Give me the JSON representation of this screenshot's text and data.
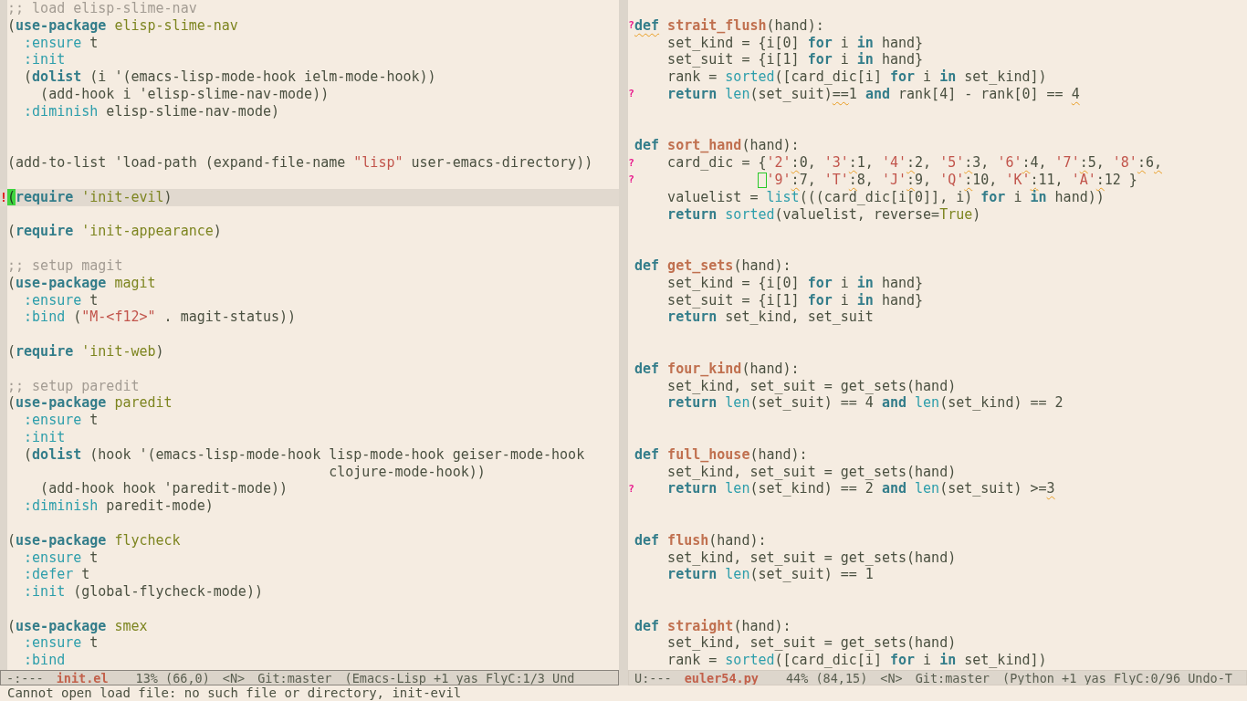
{
  "panes": [
    {
      "mode_line": {
        "active": true,
        "segments": [
          {
            "kind": "status",
            "text": "-:---"
          },
          {
            "kind": "buffer",
            "text": "init.el"
          },
          {
            "kind": "position",
            "text": "13% (66,0)"
          },
          {
            "kind": "state",
            "text": "<N>"
          },
          {
            "kind": "branch",
            "text": "Git:master"
          },
          {
            "kind": "modes",
            "text": "(Emacs-Lisp +1 yas FlyC:1/3 Und"
          }
        ]
      },
      "lines": [
        {
          "kind": "code",
          "current": false,
          "segments": [
            {
              "kind": "comment",
              "text": ";; load elisp-slime-nav"
            }
          ]
        },
        {
          "kind": "code",
          "current": false,
          "segments": [
            {
              "kind": "plain",
              "text": "("
            },
            {
              "kind": "keyword",
              "text": "use-package"
            },
            {
              "kind": "constant",
              "text": " elisp-slime-nav"
            }
          ]
        },
        {
          "kind": "code",
          "current": false,
          "segments": [
            {
              "kind": "builtin",
              "text": "  :ensure"
            },
            {
              "kind": "plain",
              "text": " t"
            }
          ]
        },
        {
          "kind": "code",
          "current": false,
          "segments": [
            {
              "kind": "builtin",
              "text": "  :init"
            }
          ]
        },
        {
          "kind": "code",
          "current": false,
          "segments": [
            {
              "kind": "plain",
              "text": "  ("
            },
            {
              "kind": "keyword",
              "text": "dolist"
            },
            {
              "kind": "plain",
              "text": " (i '(emacs-lisp-mode-hook ielm-mode-hook))"
            }
          ]
        },
        {
          "kind": "code",
          "current": false,
          "segments": [
            {
              "kind": "plain",
              "text": "    (add-hook i 'elisp-slime-nav-mode))"
            }
          ]
        },
        {
          "kind": "code",
          "current": false,
          "segments": [
            {
              "kind": "builtin",
              "text": "  :diminish"
            },
            {
              "kind": "plain",
              "text": " elisp-slime-nav-mode)"
            }
          ]
        },
        {
          "kind": "blank",
          "current": false
        },
        {
          "kind": "blank",
          "current": false
        },
        {
          "kind": "code",
          "current": false,
          "segments": [
            {
              "kind": "plain",
              "text": "(add-to-list 'load-path (expand-file-name "
            },
            {
              "kind": "string",
              "text": "\"lisp\""
            },
            {
              "kind": "plain",
              "text": " user-emacs-directory))"
            }
          ]
        },
        {
          "kind": "blank",
          "current": false
        },
        {
          "kind": "code",
          "current": true,
          "fringe": {
            "kind": "error",
            "text": "!"
          },
          "segments": [
            {
              "kind": "cursor",
              "text": "("
            },
            {
              "kind": "keyword",
              "text": "require"
            },
            {
              "kind": "constant",
              "text": " 'init-evil"
            },
            {
              "kind": "plain",
              "text": ")"
            }
          ]
        },
        {
          "kind": "blank",
          "current": false
        },
        {
          "kind": "code",
          "current": false,
          "segments": [
            {
              "kind": "plain",
              "text": "("
            },
            {
              "kind": "keyword",
              "text": "require"
            },
            {
              "kind": "constant",
              "text": " 'init-appearance"
            },
            {
              "kind": "plain",
              "text": ")"
            }
          ]
        },
        {
          "kind": "blank",
          "current": false
        },
        {
          "kind": "code",
          "current": false,
          "segments": [
            {
              "kind": "comment",
              "text": ";; setup magit"
            }
          ]
        },
        {
          "kind": "code",
          "current": false,
          "segments": [
            {
              "kind": "plain",
              "text": "("
            },
            {
              "kind": "keyword",
              "text": "use-package"
            },
            {
              "kind": "constant",
              "text": " magit"
            }
          ]
        },
        {
          "kind": "code",
          "current": false,
          "segments": [
            {
              "kind": "builtin",
              "text": "  :ensure"
            },
            {
              "kind": "plain",
              "text": " t"
            }
          ]
        },
        {
          "kind": "code",
          "current": false,
          "segments": [
            {
              "kind": "builtin",
              "text": "  :bind"
            },
            {
              "kind": "plain",
              "text": " ("
            },
            {
              "kind": "string",
              "text": "\"M-<f12>\""
            },
            {
              "kind": "plain",
              "text": " . magit-status))"
            }
          ]
        },
        {
          "kind": "blank",
          "current": false
        },
        {
          "kind": "code",
          "current": false,
          "segments": [
            {
              "kind": "plain",
              "text": "("
            },
            {
              "kind": "keyword",
              "text": "require"
            },
            {
              "kind": "constant",
              "text": " 'init-web"
            },
            {
              "kind": "plain",
              "text": ")"
            }
          ]
        },
        {
          "kind": "blank",
          "current": false
        },
        {
          "kind": "code",
          "current": false,
          "segments": [
            {
              "kind": "comment",
              "text": ";; setup paredit"
            }
          ]
        },
        {
          "kind": "code",
          "current": false,
          "segments": [
            {
              "kind": "plain",
              "text": "("
            },
            {
              "kind": "keyword",
              "text": "use-package"
            },
            {
              "kind": "constant",
              "text": " paredit"
            }
          ]
        },
        {
          "kind": "code",
          "current": false,
          "segments": [
            {
              "kind": "builtin",
              "text": "  :ensure"
            },
            {
              "kind": "plain",
              "text": " t"
            }
          ]
        },
        {
          "kind": "code",
          "current": false,
          "segments": [
            {
              "kind": "builtin",
              "text": "  :init"
            }
          ]
        },
        {
          "kind": "code",
          "current": false,
          "segments": [
            {
              "kind": "plain",
              "text": "  ("
            },
            {
              "kind": "keyword",
              "text": "dolist"
            },
            {
              "kind": "plain",
              "text": " (hook '(emacs-lisp-mode-hook lisp-mode-hook geiser-mode-hook"
            }
          ]
        },
        {
          "kind": "code",
          "current": false,
          "segments": [
            {
              "kind": "plain",
              "text": "                                       clojure-mode-hook))"
            }
          ]
        },
        {
          "kind": "code",
          "current": false,
          "segments": [
            {
              "kind": "plain",
              "text": "    (add-hook hook 'paredit-mode))"
            }
          ]
        },
        {
          "kind": "code",
          "current": false,
          "segments": [
            {
              "kind": "builtin",
              "text": "  :diminish"
            },
            {
              "kind": "plain",
              "text": " paredit-mode)"
            }
          ]
        },
        {
          "kind": "blank",
          "current": false
        },
        {
          "kind": "code",
          "current": false,
          "segments": [
            {
              "kind": "plain",
              "text": "("
            },
            {
              "kind": "keyword",
              "text": "use-package"
            },
            {
              "kind": "constant",
              "text": " flycheck"
            }
          ]
        },
        {
          "kind": "code",
          "current": false,
          "segments": [
            {
              "kind": "builtin",
              "text": "  :ensure"
            },
            {
              "kind": "plain",
              "text": " t"
            }
          ]
        },
        {
          "kind": "code",
          "current": false,
          "segments": [
            {
              "kind": "builtin",
              "text": "  :defer"
            },
            {
              "kind": "plain",
              "text": " t"
            }
          ]
        },
        {
          "kind": "code",
          "current": false,
          "segments": [
            {
              "kind": "builtin",
              "text": "  :init"
            },
            {
              "kind": "plain",
              "text": " (global-flycheck-mode))"
            }
          ]
        },
        {
          "kind": "blank",
          "current": false
        },
        {
          "kind": "code",
          "current": false,
          "segments": [
            {
              "kind": "plain",
              "text": "("
            },
            {
              "kind": "keyword",
              "text": "use-package"
            },
            {
              "kind": "constant",
              "text": " smex"
            }
          ]
        },
        {
          "kind": "code",
          "current": false,
          "segments": [
            {
              "kind": "builtin",
              "text": "  :ensure"
            },
            {
              "kind": "plain",
              "text": " t"
            }
          ]
        },
        {
          "kind": "code",
          "current": false,
          "segments": [
            {
              "kind": "builtin",
              "text": "  :bind"
            }
          ]
        }
      ]
    },
    {
      "mode_line": {
        "active": false,
        "segments": [
          {
            "kind": "status",
            "text": "U:---"
          },
          {
            "kind": "buffer",
            "text": "euler54.py"
          },
          {
            "kind": "position",
            "text": "44% (84,15)"
          },
          {
            "kind": "state",
            "text": "<N>"
          },
          {
            "kind": "branch",
            "text": "Git:master"
          },
          {
            "kind": "modes",
            "text": "(Python +1 yas FlyC:0/96 Undo-T"
          }
        ]
      },
      "lines": [
        {
          "kind": "blank"
        },
        {
          "kind": "code",
          "fringe": {
            "kind": "warning",
            "text": "?"
          },
          "segments": [
            {
              "kind": "flagged_keyword",
              "text": "def"
            },
            {
              "kind": "function",
              "text": " strait_flush"
            },
            {
              "kind": "plain",
              "text": "(hand):"
            }
          ]
        },
        {
          "kind": "code",
          "segments": [
            {
              "kind": "plain",
              "text": "    set_kind = {i[0] "
            },
            {
              "kind": "keyword",
              "text": "for"
            },
            {
              "kind": "plain",
              "text": " i "
            },
            {
              "kind": "keyword",
              "text": "in"
            },
            {
              "kind": "plain",
              "text": " hand}"
            }
          ]
        },
        {
          "kind": "code",
          "segments": [
            {
              "kind": "plain",
              "text": "    set_suit = {i[1] "
            },
            {
              "kind": "keyword",
              "text": "for"
            },
            {
              "kind": "plain",
              "text": " i "
            },
            {
              "kind": "keyword",
              "text": "in"
            },
            {
              "kind": "plain",
              "text": " hand}"
            }
          ]
        },
        {
          "kind": "code",
          "segments": [
            {
              "kind": "plain",
              "text": "    rank = "
            },
            {
              "kind": "builtin",
              "text": "sorted"
            },
            {
              "kind": "plain",
              "text": "([card_dic[i] "
            },
            {
              "kind": "keyword",
              "text": "for"
            },
            {
              "kind": "plain",
              "text": " i "
            },
            {
              "kind": "keyword",
              "text": "in"
            },
            {
              "kind": "plain",
              "text": " set_kind])"
            }
          ]
        },
        {
          "kind": "code",
          "fringe": {
            "kind": "warning",
            "text": "?"
          },
          "segments": [
            {
              "kind": "keyword",
              "text": "    return"
            },
            {
              "kind": "builtin",
              "text": " len"
            },
            {
              "kind": "plain",
              "text": "(set_suit)"
            },
            {
              "kind": "flagged",
              "text": "=="
            },
            {
              "kind": "plain",
              "text": "1 "
            },
            {
              "kind": "keyword",
              "text": "and"
            },
            {
              "kind": "plain",
              "text": " rank[4] - rank[0] == "
            },
            {
              "kind": "flagged",
              "text": "4"
            }
          ]
        },
        {
          "kind": "blank"
        },
        {
          "kind": "blank"
        },
        {
          "kind": "code",
          "segments": [
            {
              "kind": "keyword",
              "text": "def"
            },
            {
              "kind": "function",
              "text": " sort_hand"
            },
            {
              "kind": "plain",
              "text": "(hand):"
            }
          ]
        },
        {
          "kind": "code",
          "fringe": {
            "kind": "warning",
            "text": "?"
          },
          "segments": [
            {
              "kind": "plain",
              "text": "    card_dic = {"
            },
            {
              "kind": "string",
              "text": "'2'"
            },
            {
              "kind": "flagged",
              "text": ":"
            },
            {
              "kind": "plain",
              "text": "0, "
            },
            {
              "kind": "string",
              "text": "'3'"
            },
            {
              "kind": "flagged",
              "text": ":"
            },
            {
              "kind": "plain",
              "text": "1, "
            },
            {
              "kind": "string",
              "text": "'4'"
            },
            {
              "kind": "flagged",
              "text": ":"
            },
            {
              "kind": "plain",
              "text": "2, "
            },
            {
              "kind": "string",
              "text": "'5'"
            },
            {
              "kind": "flagged",
              "text": ":"
            },
            {
              "kind": "plain",
              "text": "3, "
            },
            {
              "kind": "string",
              "text": "'6'"
            },
            {
              "kind": "flagged",
              "text": ":"
            },
            {
              "kind": "plain",
              "text": "4, "
            },
            {
              "kind": "string",
              "text": "'7'"
            },
            {
              "kind": "flagged",
              "text": ":"
            },
            {
              "kind": "plain",
              "text": "5, "
            },
            {
              "kind": "string",
              "text": "'8'"
            },
            {
              "kind": "flagged",
              "text": ":"
            },
            {
              "kind": "plain",
              "text": "6"
            },
            {
              "kind": "flagged",
              "text": ","
            }
          ]
        },
        {
          "kind": "code",
          "fringe": {
            "kind": "warning",
            "text": "?"
          },
          "segments": [
            {
              "kind": "box_cursor_string",
              "text": "                '9'"
            },
            {
              "kind": "flagged",
              "text": ":"
            },
            {
              "kind": "plain",
              "text": "7, "
            },
            {
              "kind": "string",
              "text": "'T'"
            },
            {
              "kind": "flagged",
              "text": ":"
            },
            {
              "kind": "plain",
              "text": "8, "
            },
            {
              "kind": "string",
              "text": "'J'"
            },
            {
              "kind": "flagged",
              "text": ":"
            },
            {
              "kind": "plain",
              "text": "9, "
            },
            {
              "kind": "string",
              "text": "'Q'"
            },
            {
              "kind": "flagged",
              "text": ":"
            },
            {
              "kind": "plain",
              "text": "10, "
            },
            {
              "kind": "string",
              "text": "'K'"
            },
            {
              "kind": "flagged",
              "text": ":"
            },
            {
              "kind": "plain",
              "text": "11, "
            },
            {
              "kind": "string",
              "text": "'A'"
            },
            {
              "kind": "flagged",
              "text": ":"
            },
            {
              "kind": "plain",
              "text": "12 }"
            }
          ]
        },
        {
          "kind": "code",
          "segments": [
            {
              "kind": "plain",
              "text": "    valuelist = "
            },
            {
              "kind": "builtin",
              "text": "list"
            },
            {
              "kind": "plain",
              "text": "(((card_dic[i[0]], i) "
            },
            {
              "kind": "keyword",
              "text": "for"
            },
            {
              "kind": "plain",
              "text": " i "
            },
            {
              "kind": "keyword",
              "text": "in"
            },
            {
              "kind": "plain",
              "text": " hand))"
            }
          ]
        },
        {
          "kind": "code",
          "segments": [
            {
              "kind": "keyword",
              "text": "    return"
            },
            {
              "kind": "builtin",
              "text": " sorted"
            },
            {
              "kind": "plain",
              "text": "(valuelist, reverse="
            },
            {
              "kind": "constant",
              "text": "True"
            },
            {
              "kind": "plain",
              "text": ")"
            }
          ]
        },
        {
          "kind": "blank"
        },
        {
          "kind": "blank"
        },
        {
          "kind": "code",
          "segments": [
            {
              "kind": "keyword",
              "text": "def"
            },
            {
              "kind": "function",
              "text": " get_sets"
            },
            {
              "kind": "plain",
              "text": "(hand):"
            }
          ]
        },
        {
          "kind": "code",
          "segments": [
            {
              "kind": "plain",
              "text": "    set_kind = {i[0] "
            },
            {
              "kind": "keyword",
              "text": "for"
            },
            {
              "kind": "plain",
              "text": " i "
            },
            {
              "kind": "keyword",
              "text": "in"
            },
            {
              "kind": "plain",
              "text": " hand}"
            }
          ]
        },
        {
          "kind": "code",
          "segments": [
            {
              "kind": "plain",
              "text": "    set_suit = {i[1] "
            },
            {
              "kind": "keyword",
              "text": "for"
            },
            {
              "kind": "plain",
              "text": " i "
            },
            {
              "kind": "keyword",
              "text": "in"
            },
            {
              "kind": "plain",
              "text": " hand}"
            }
          ]
        },
        {
          "kind": "code",
          "segments": [
            {
              "kind": "keyword",
              "text": "    return"
            },
            {
              "kind": "plain",
              "text": " set_kind, set_suit"
            }
          ]
        },
        {
          "kind": "blank"
        },
        {
          "kind": "blank"
        },
        {
          "kind": "code",
          "segments": [
            {
              "kind": "keyword",
              "text": "def"
            },
            {
              "kind": "function",
              "text": " four_kind"
            },
            {
              "kind": "plain",
              "text": "(hand):"
            }
          ]
        },
        {
          "kind": "code",
          "segments": [
            {
              "kind": "plain",
              "text": "    set_kind, set_suit = get_sets(hand)"
            }
          ]
        },
        {
          "kind": "code",
          "segments": [
            {
              "kind": "keyword",
              "text": "    return"
            },
            {
              "kind": "builtin",
              "text": " len"
            },
            {
              "kind": "plain",
              "text": "(set_suit) == 4 "
            },
            {
              "kind": "keyword",
              "text": "and"
            },
            {
              "kind": "builtin",
              "text": " len"
            },
            {
              "kind": "plain",
              "text": "(set_kind) == 2"
            }
          ]
        },
        {
          "kind": "blank"
        },
        {
          "kind": "blank"
        },
        {
          "kind": "code",
          "segments": [
            {
              "kind": "keyword",
              "text": "def"
            },
            {
              "kind": "function",
              "text": " full_house"
            },
            {
              "kind": "plain",
              "text": "(hand):"
            }
          ]
        },
        {
          "kind": "code",
          "segments": [
            {
              "kind": "plain",
              "text": "    set_kind, set_suit = get_sets(hand)"
            }
          ]
        },
        {
          "kind": "code",
          "fringe": {
            "kind": "warning",
            "text": "?"
          },
          "segments": [
            {
              "kind": "keyword",
              "text": "    return"
            },
            {
              "kind": "builtin",
              "text": " len"
            },
            {
              "kind": "plain",
              "text": "(set_kind) == 2 "
            },
            {
              "kind": "keyword",
              "text": "and"
            },
            {
              "kind": "builtin",
              "text": " len"
            },
            {
              "kind": "plain",
              "text": "(set_suit) >="
            },
            {
              "kind": "flagged",
              "text": "3"
            }
          ]
        },
        {
          "kind": "blank"
        },
        {
          "kind": "blank"
        },
        {
          "kind": "code",
          "segments": [
            {
              "kind": "keyword",
              "text": "def"
            },
            {
              "kind": "function",
              "text": " flush"
            },
            {
              "kind": "plain",
              "text": "(hand):"
            }
          ]
        },
        {
          "kind": "code",
          "segments": [
            {
              "kind": "plain",
              "text": "    set_kind, set_suit = get_sets(hand)"
            }
          ]
        },
        {
          "kind": "code",
          "segments": [
            {
              "kind": "keyword",
              "text": "    return"
            },
            {
              "kind": "builtin",
              "text": " len"
            },
            {
              "kind": "plain",
              "text": "(set_suit) == 1"
            }
          ]
        },
        {
          "kind": "blank"
        },
        {
          "kind": "blank"
        },
        {
          "kind": "code",
          "segments": [
            {
              "kind": "keyword",
              "text": "def"
            },
            {
              "kind": "function",
              "text": " straight"
            },
            {
              "kind": "plain",
              "text": "(hand):"
            }
          ]
        },
        {
          "kind": "code",
          "segments": [
            {
              "kind": "plain",
              "text": "    set_kind, set_suit = get_sets(hand)"
            }
          ]
        },
        {
          "kind": "code",
          "segments": [
            {
              "kind": "plain",
              "text": "    rank = "
            },
            {
              "kind": "builtin",
              "text": "sorted"
            },
            {
              "kind": "plain",
              "text": "([card_dic[i] "
            },
            {
              "kind": "keyword",
              "text": "for"
            },
            {
              "kind": "plain",
              "text": " i "
            },
            {
              "kind": "keyword",
              "text": "in"
            },
            {
              "kind": "plain",
              "text": " set_kind])"
            }
          ]
        }
      ]
    }
  ],
  "echo_area": {
    "message": "Cannot open load file: no such file or directory, init-evil"
  }
}
